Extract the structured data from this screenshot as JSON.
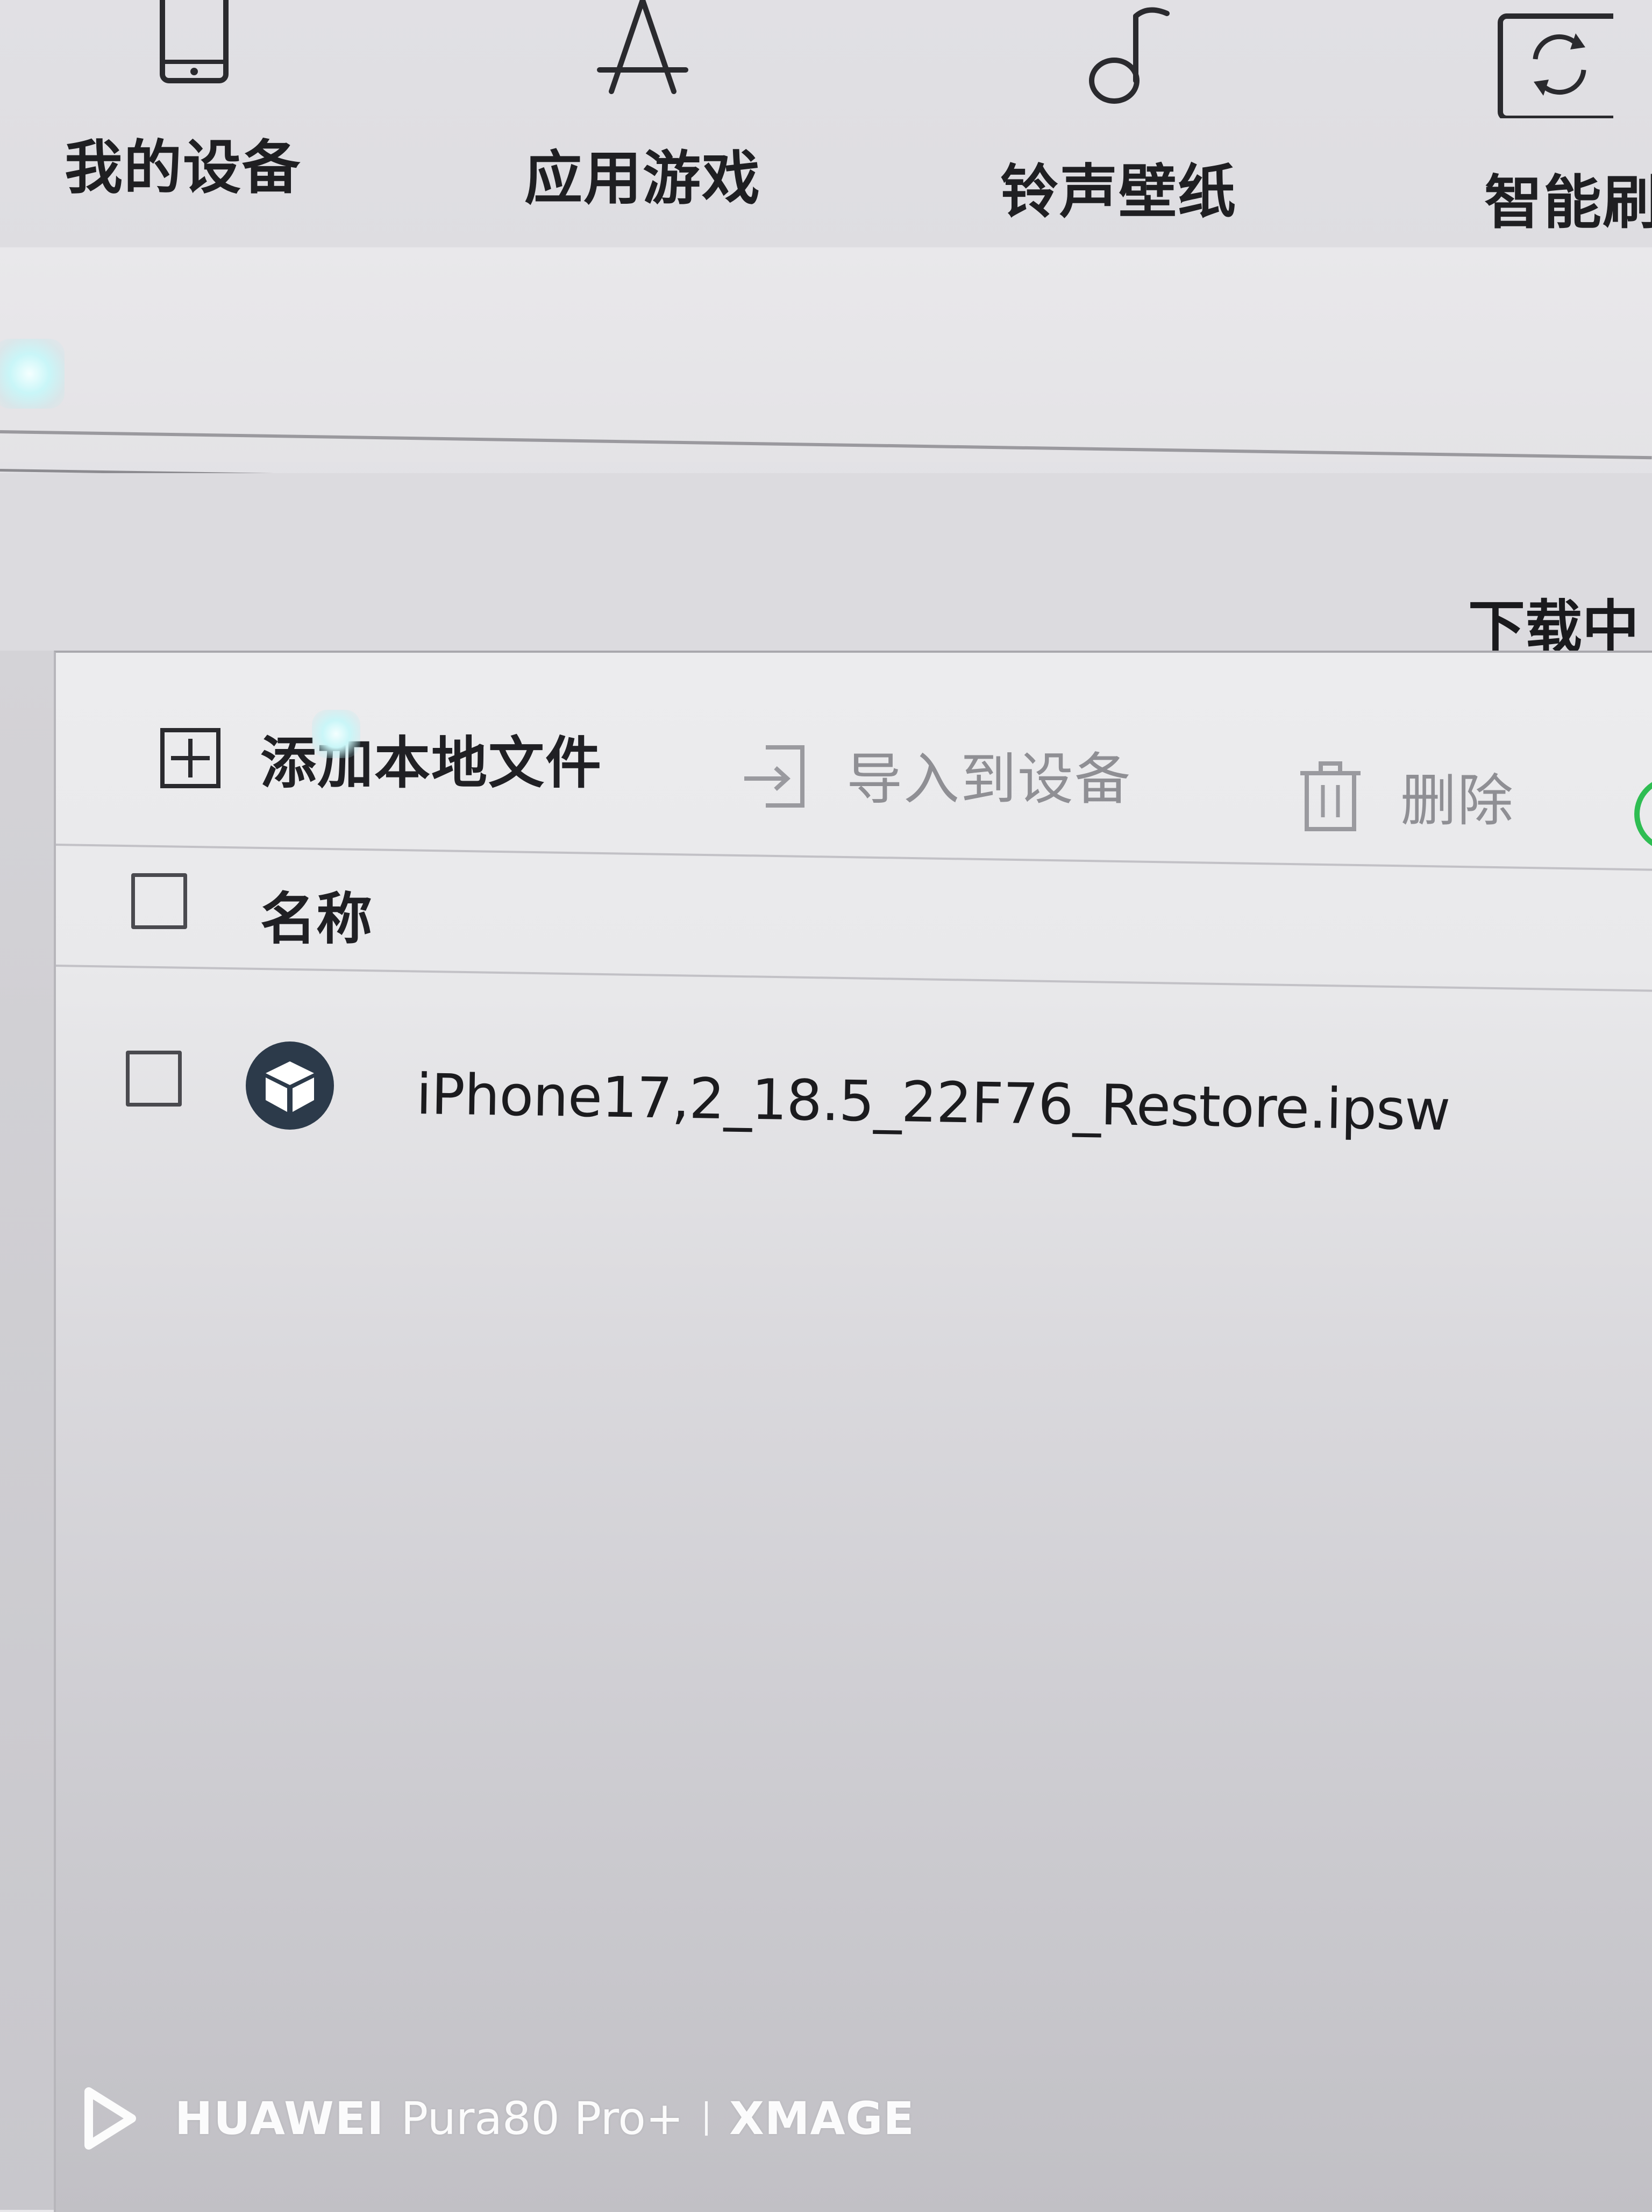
{
  "top_nav": {
    "items": [
      {
        "label": "我的设备",
        "icon": "phone-icon"
      },
      {
        "label": "应用游戏",
        "icon": "app-store-icon"
      },
      {
        "label": "铃声壁纸",
        "icon": "music-note-icon"
      },
      {
        "label": "智能刷",
        "icon": "flash-refresh-icon"
      }
    ]
  },
  "tabs": {
    "downloading_label": "下载中"
  },
  "toolbar": {
    "add_label": "添加本地文件",
    "import_label": "导入到设备",
    "delete_label": "删除"
  },
  "table": {
    "header_name": "名称",
    "rows": [
      {
        "name": "iPhone17,2_18.5_22F76_Restore.ipsw",
        "icon": "package-icon"
      }
    ]
  },
  "watermark": {
    "brand": "HUAWEI",
    "model": "Pura80 Pro+",
    "xmage": "XMAGE"
  },
  "colors": {
    "refresh_accent": "#2ebd52",
    "package_icon_bg": "#2c3a4a"
  }
}
